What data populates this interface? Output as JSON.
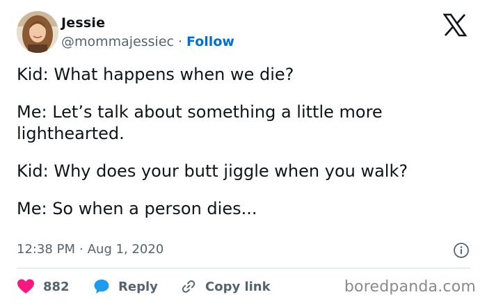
{
  "author": {
    "name": "Jessie",
    "handle": "@mommajessiec",
    "separator": "·",
    "follow_label": "Follow"
  },
  "tweet": {
    "paragraphs": [
      "Kid: What happens when we die?",
      "Me: Let’s talk about something a little more lighthearted.",
      "Kid: Why does your butt jiggle when you walk?",
      "Me: So when a person dies..."
    ],
    "time": "12:38 PM",
    "date_separator": "·",
    "date": "Aug 1, 2020"
  },
  "actions": {
    "like_count": "882",
    "reply_label": "Reply",
    "copy_label": "Copy link"
  },
  "icons": {
    "platform": "x-logo-icon",
    "like": "heart-icon",
    "reply": "speech-bubble-icon",
    "copy": "link-icon",
    "info": "info-icon"
  },
  "colors": {
    "text": "#0f1419",
    "secondary": "#536471",
    "follow": "#006fd6",
    "heart": "#f91880",
    "reply_bubble": "#1d9bf0",
    "divider": "#cfd9de",
    "watermark": "#8a8a8a"
  },
  "watermark": "boredpanda.com"
}
